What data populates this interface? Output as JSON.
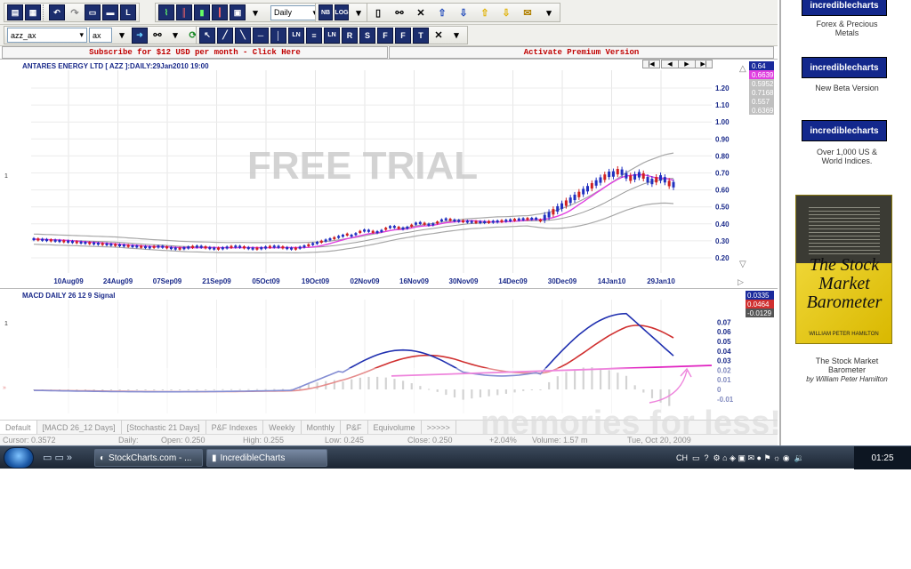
{
  "toolbar1": {
    "period_select": "Daily",
    "buttons": [
      "print-icon",
      "preview-icon",
      "undo-icon",
      "redo-icon",
      "bar-chart-icon",
      "window-icon",
      "L"
    ],
    "scale_buttons": [
      "NB",
      "LOG"
    ]
  },
  "toolbar2": {
    "symbol_input": "azz_ax",
    "exchange_select": "ax"
  },
  "banners": {
    "subscribe": "Subscribe for $12 USD per month - Click Here",
    "activate": "Activate Premium Version"
  },
  "price_chart": {
    "title": "ANTARES ENERGY LTD [ AZZ ]:DAILY:29Jan2010 19:00",
    "left_marker": "1",
    "y_ticks": [
      "1.20",
      "1.10",
      "1.00",
      "0.90",
      "0.80",
      "0.70",
      "0.60",
      "0.50",
      "0.40",
      "0.30",
      "0.20"
    ],
    "x_ticks": [
      "10Aug09",
      "24Aug09",
      "07Sep09",
      "21Sep09",
      "05Oct09",
      "19Oct09",
      "02Nov09",
      "16Nov09",
      "30Nov09",
      "14Dec09",
      "30Dec09",
      "14Jan10",
      "29Jan10"
    ],
    "legend_values": [
      {
        "text": "0.64",
        "bg": "#1a2a9c",
        "fg": "#ffffff"
      },
      {
        "text": "0.6639",
        "bg": "#e040e0",
        "fg": "#ffffff"
      },
      {
        "text": "0.5952",
        "bg": "#c0c0c0",
        "fg": "#ffffff"
      },
      {
        "text": "0.7168",
        "bg": "#c0c0c0",
        "fg": "#ffffff"
      },
      {
        "text": "0.557",
        "bg": "#c0c0c0",
        "fg": "#ffffff"
      },
      {
        "text": "0.6369",
        "bg": "#c0c0c0",
        "fg": "#ffffff"
      }
    ],
    "nav_buttons": [
      "|◀",
      "◀",
      "▶",
      "▶|"
    ]
  },
  "macd_chart": {
    "title": "MACD DAILY 26 12 9 Signal",
    "left_marker": "1",
    "y_ticks": [
      "0.07",
      "0.06",
      "0.05",
      "0.04",
      "0.03",
      "0.02",
      "0.01",
      "0",
      "-0.01"
    ],
    "legend_values": [
      {
        "text": "0.0335",
        "bg": "#1a2a9c",
        "fg": "#ffffff"
      },
      {
        "text": "0.0464",
        "bg": "#d03030",
        "fg": "#ffffff"
      },
      {
        "text": "-0.0129",
        "bg": "#555555",
        "fg": "#ffffff"
      }
    ]
  },
  "watermark": "FREE TRIAL",
  "watermark2": "memories for less!",
  "tabs": [
    "Default",
    "[MACD 26_12 Days]",
    "[Stochastic 21 Days]",
    "P&F Indexes",
    "Weekly",
    "Monthly",
    "P&F",
    "Equivolume",
    ">>>>>"
  ],
  "status": {
    "cursor": "Cursor: 0.3572",
    "period": "Daily:",
    "open": "Open: 0.250",
    "high": "High: 0.255",
    "low": "Low: 0.245",
    "close": "Close: 0.250",
    "change": "+2.04%",
    "volume": "Volume: 1.57 m",
    "date": "Tue, Oct 20, 2009"
  },
  "taskbar": {
    "items": [
      "StockCharts.com - ...",
      "IncredibleCharts"
    ],
    "lang": "CH",
    "time": "01:25"
  },
  "sidebar": {
    "ads": [
      {
        "logo": "incrediblecharts",
        "text": "Forex & Precious Metals"
      },
      {
        "logo": "incrediblecharts",
        "text": "New Beta Version"
      },
      {
        "logo": "incrediblecharts",
        "text": "Over 1,000 US & World Indices."
      }
    ],
    "book": {
      "title": "The Stock Market Barometer",
      "author": "WILLIAM PETER HAMILTON",
      "caption": "The Stock Market Barometer",
      "byline": "by William Peter Hamilton"
    }
  }
}
